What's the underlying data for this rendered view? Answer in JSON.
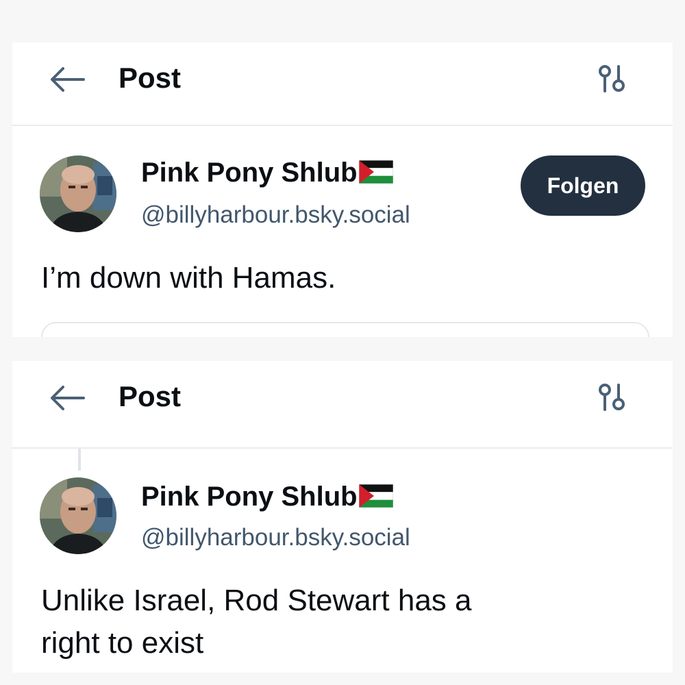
{
  "posts": [
    {
      "header": {
        "title": "Post",
        "back_icon": "arrow-left-icon",
        "settings_icon": "sliders-icon"
      },
      "author": {
        "name": "Pink Pony Shlub",
        "flag_icon": "palestine-flag-icon",
        "handle": "@billyharbour.bsky.social"
      },
      "follow_label": "Folgen",
      "text": "I’m down with Hamas."
    },
    {
      "header": {
        "title": "Post",
        "back_icon": "arrow-left-icon",
        "settings_icon": "sliders-icon"
      },
      "author": {
        "name": "Pink Pony Shlub",
        "flag_icon": "palestine-flag-icon",
        "handle": "@billyharbour.bsky.social"
      },
      "text_lines": [
        "Unlike Israel, Rod Stewart has a",
        "right to exist"
      ]
    }
  ],
  "colors": {
    "accent": "#233040",
    "icon": "#4a6075",
    "handle": "#42576c",
    "text": "#0b0f14",
    "divider": "#e8ecef"
  }
}
